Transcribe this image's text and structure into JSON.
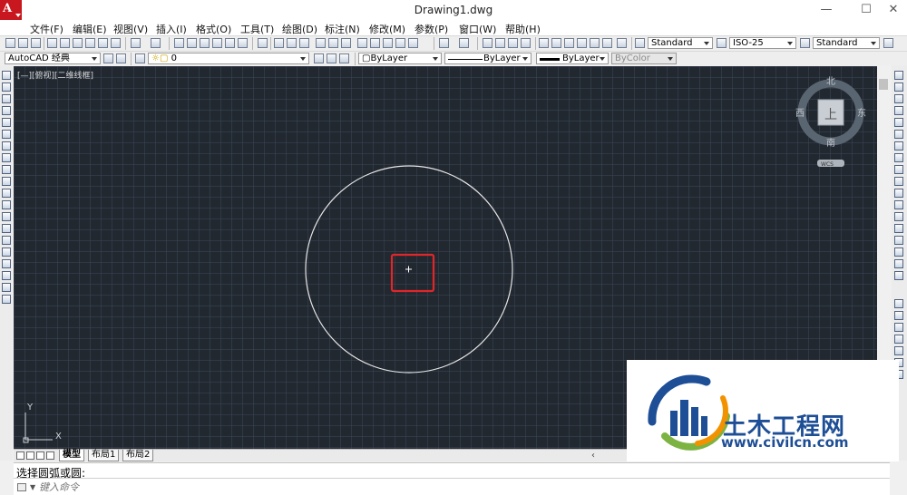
{
  "window": {
    "title": "Drawing1.dwg",
    "minimize_glyph": "—",
    "maximize_glyph": "☐",
    "close_glyph": "✕",
    "logo_letter": "A"
  },
  "menu": [
    "文件(F)",
    "编辑(E)",
    "视图(V)",
    "插入(I)",
    "格式(O)",
    "工具(T)",
    "绘图(D)",
    "标注(N)",
    "修改(M)",
    "参数(P)",
    "窗口(W)",
    "帮助(H)"
  ],
  "toolbar": {
    "text_style": "Standard",
    "dim_style": "ISO-25",
    "table_style": "Standard",
    "workspace": "AutoCAD 经典",
    "layer": "0",
    "color": "ByLayer",
    "linetype": "ByLayer",
    "lineweight": "ByLayer",
    "plot_style": "ByColor"
  },
  "viewport": {
    "label": "[—][俯视][二维线框]",
    "background": "#212830",
    "grid_color": "#3c4655",
    "circle_color": "#e6e6e6",
    "highlight_color": "#e0262a",
    "viewcube": {
      "top": "上",
      "north": "北",
      "south": "南",
      "east": "东",
      "west": "西",
      "wcs": "WCS"
    },
    "ucs": {
      "x": "X",
      "y": "Y"
    }
  },
  "tabs": [
    "模型",
    "布局1",
    "布局2"
  ],
  "command": {
    "history": "选择圆弧或圆:",
    "placeholder": "键入命令"
  },
  "watermark": {
    "brand": "土木工程网",
    "url": "www.civilcn.com",
    "colors": {
      "blue": "#1d4e96",
      "green": "#7cb342",
      "orange": "#f39200"
    }
  }
}
